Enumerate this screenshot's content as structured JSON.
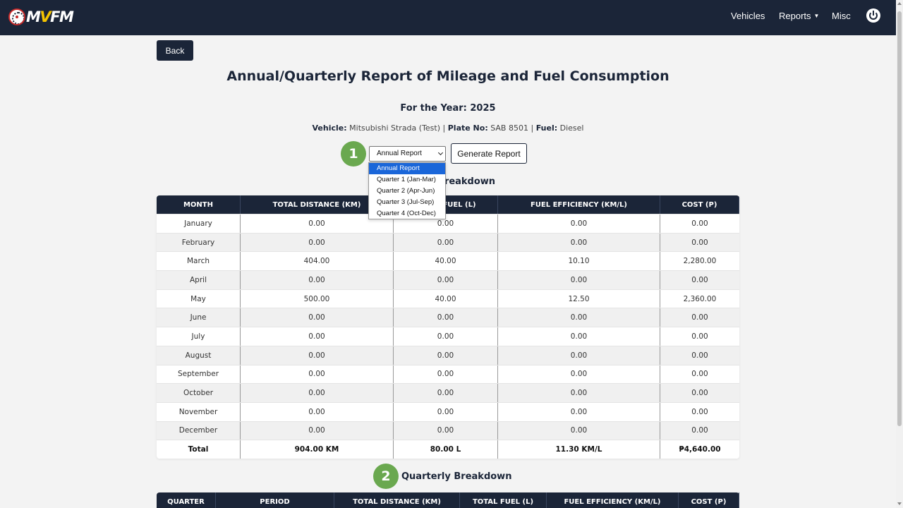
{
  "navbar": {
    "logo": {
      "text_m": "M",
      "text_v": "V",
      "text_fm": "FM"
    },
    "links": {
      "vehicles": "Vehicles",
      "reports": "Reports",
      "reports_caret": "▼",
      "misc": "Misc"
    }
  },
  "page": {
    "back_label": "Back",
    "title": "Annual/Quarterly Report of Mileage and Fuel Consumption",
    "year_line": "For the Year: 2025",
    "vehicle": {
      "vehicle_label": "Vehicle:",
      "vehicle_value": "Mitsubishi Strada (Test)",
      "plate_label": "Plate No:",
      "plate_value": "SAB 8501",
      "fuel_label": "Fuel:",
      "fuel_value": "Diesel",
      "separator": "|"
    },
    "step_badges": [
      "1",
      "2"
    ]
  },
  "report_select": {
    "selected": "Annual Report",
    "options": [
      "Annual Report",
      "Quarter 1 (Jan-Mar)",
      "Quarter 2 (Apr-Jun)",
      "Quarter 3 (Jul-Sep)",
      "Quarter 4 (Oct-Dec)"
    ],
    "generate_label": "Generate Report"
  },
  "monthly": {
    "section_title": "Breakdown",
    "headers": [
      "MONTH",
      "TOTAL DISTANCE (KM)",
      "TOTAL FUEL (L)",
      "FUEL EFFICIENCY (KM/L)",
      "COST (P)"
    ],
    "rows": [
      [
        "January",
        "0.00",
        "0.00",
        "0.00",
        "0.00"
      ],
      [
        "February",
        "0.00",
        "0.00",
        "0.00",
        "0.00"
      ],
      [
        "March",
        "404.00",
        "40.00",
        "10.10",
        "2,280.00"
      ],
      [
        "April",
        "0.00",
        "0.00",
        "0.00",
        "0.00"
      ],
      [
        "May",
        "500.00",
        "40.00",
        "12.50",
        "2,360.00"
      ],
      [
        "June",
        "0.00",
        "0.00",
        "0.00",
        "0.00"
      ],
      [
        "July",
        "0.00",
        "0.00",
        "0.00",
        "0.00"
      ],
      [
        "August",
        "0.00",
        "0.00",
        "0.00",
        "0.00"
      ],
      [
        "September",
        "0.00",
        "0.00",
        "0.00",
        "0.00"
      ],
      [
        "October",
        "0.00",
        "0.00",
        "0.00",
        "0.00"
      ],
      [
        "November",
        "0.00",
        "0.00",
        "0.00",
        "0.00"
      ],
      [
        "December",
        "0.00",
        "0.00",
        "0.00",
        "0.00"
      ]
    ],
    "total": [
      "Total",
      "904.00 KM",
      "80.00 L",
      "11.30 KM/L",
      "₱4,640.00"
    ]
  },
  "quarterly": {
    "section_title": "Quarterly Breakdown",
    "headers": [
      "QUARTER",
      "PERIOD",
      "TOTAL DISTANCE (KM)",
      "TOTAL FUEL (L)",
      "FUEL EFFICIENCY (KM/L)",
      "COST (P)"
    ]
  },
  "colors": {
    "navbar": "#1b2538",
    "accent_green": "#6aa84f",
    "select_highlight": "#1a66d9",
    "logo_v": "#f5c400"
  }
}
